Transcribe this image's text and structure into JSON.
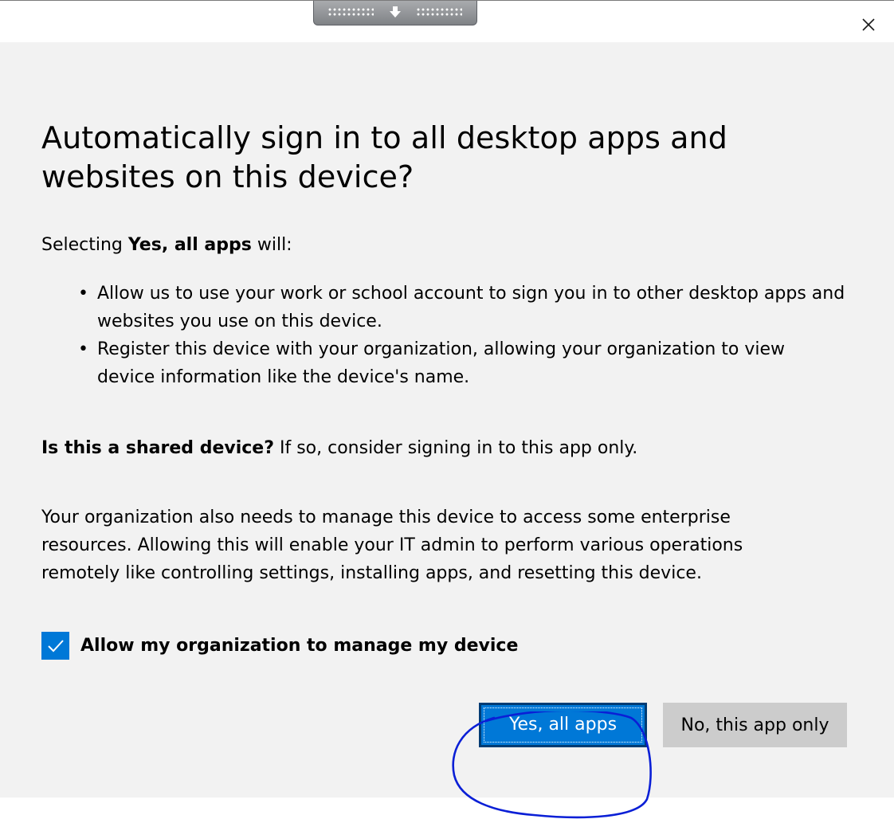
{
  "dialog": {
    "title": "Automatically sign in to all desktop apps and websites on this device?",
    "intro": {
      "prefix": "Selecting ",
      "emphasis": "Yes, all apps",
      "suffix": " will:"
    },
    "bullets": [
      "Allow us to use your work or school account to sign you in to other desktop apps and websites you use on this device.",
      "Register this device with your organization, allowing your organization to view device information like the device's name."
    ],
    "bullet_glyph": "•",
    "shared": {
      "emphasis": "Is this a shared device?",
      "text": " If so, consider signing in to this app only."
    },
    "manage_text": "Your organization also needs to manage this device to access some enterprise resources. Allowing this will enable your IT admin to perform various operations remotely like controlling settings, installing apps, and resetting this device.",
    "checkbox": {
      "label": "Allow my organization to manage my device",
      "checked": true
    },
    "buttons": {
      "primary": "Yes, all apps",
      "secondary": "No, this app only"
    }
  },
  "icons": {
    "close": "close-icon",
    "check": "checkmark-icon",
    "rdp_arrow": "arrow-down-icon"
  },
  "colors": {
    "accent": "#0078d7",
    "primary_border": "#003c74",
    "dialog_background": "#f2f2f2",
    "secondary_button": "#cccccc",
    "annotation_ink": "#0a1fd6"
  }
}
